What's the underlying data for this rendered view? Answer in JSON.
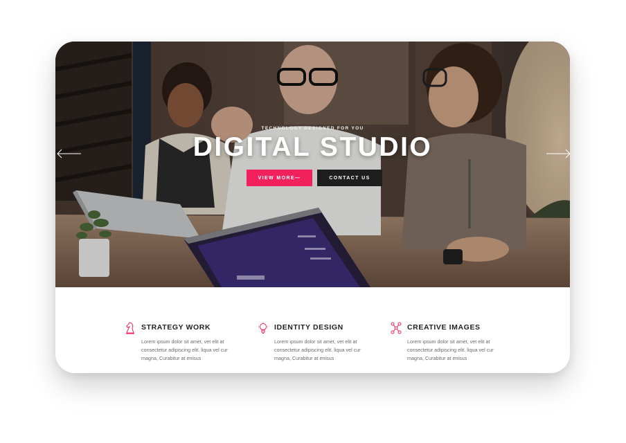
{
  "hero": {
    "subtitle": "TECHNOLOGY DESIGNED FOR YOU",
    "title": "DIGITAL STUDIO",
    "buttons": {
      "view_more": "VIEW MORE—",
      "contact_us": "CONTACT US"
    },
    "nav": {
      "prev_icon": "arrow-left-icon",
      "next_icon": "arrow-right-icon"
    }
  },
  "features": [
    {
      "icon": "chess-knight-icon",
      "title": "STRATEGY WORK",
      "text": "Lorem ipsum dolor sit amet, vet elit at consectetur adipiscing elit. liqua vel cur magna, Curabitur at enisus"
    },
    {
      "icon": "lightbulb-icon",
      "title": "IDENTITY DESIGN",
      "text": "Lorem ipsum dolor sit amet, vet elit at consectetur adipiscing elit. liqua vel cur magna, Curabitur at enisus"
    },
    {
      "icon": "network-icon",
      "title": "CREATIVE IMAGES",
      "text": "Lorem ipsum dolor sit amet, vet elit at consectetur adipiscing elit. liqua vel cur magna, Curabitur at enisus"
    }
  ],
  "colors": {
    "accent": "#f0215d",
    "dark_button": "#1e1e1e",
    "heading": "#222222",
    "body_text": "#6b6b6b"
  }
}
